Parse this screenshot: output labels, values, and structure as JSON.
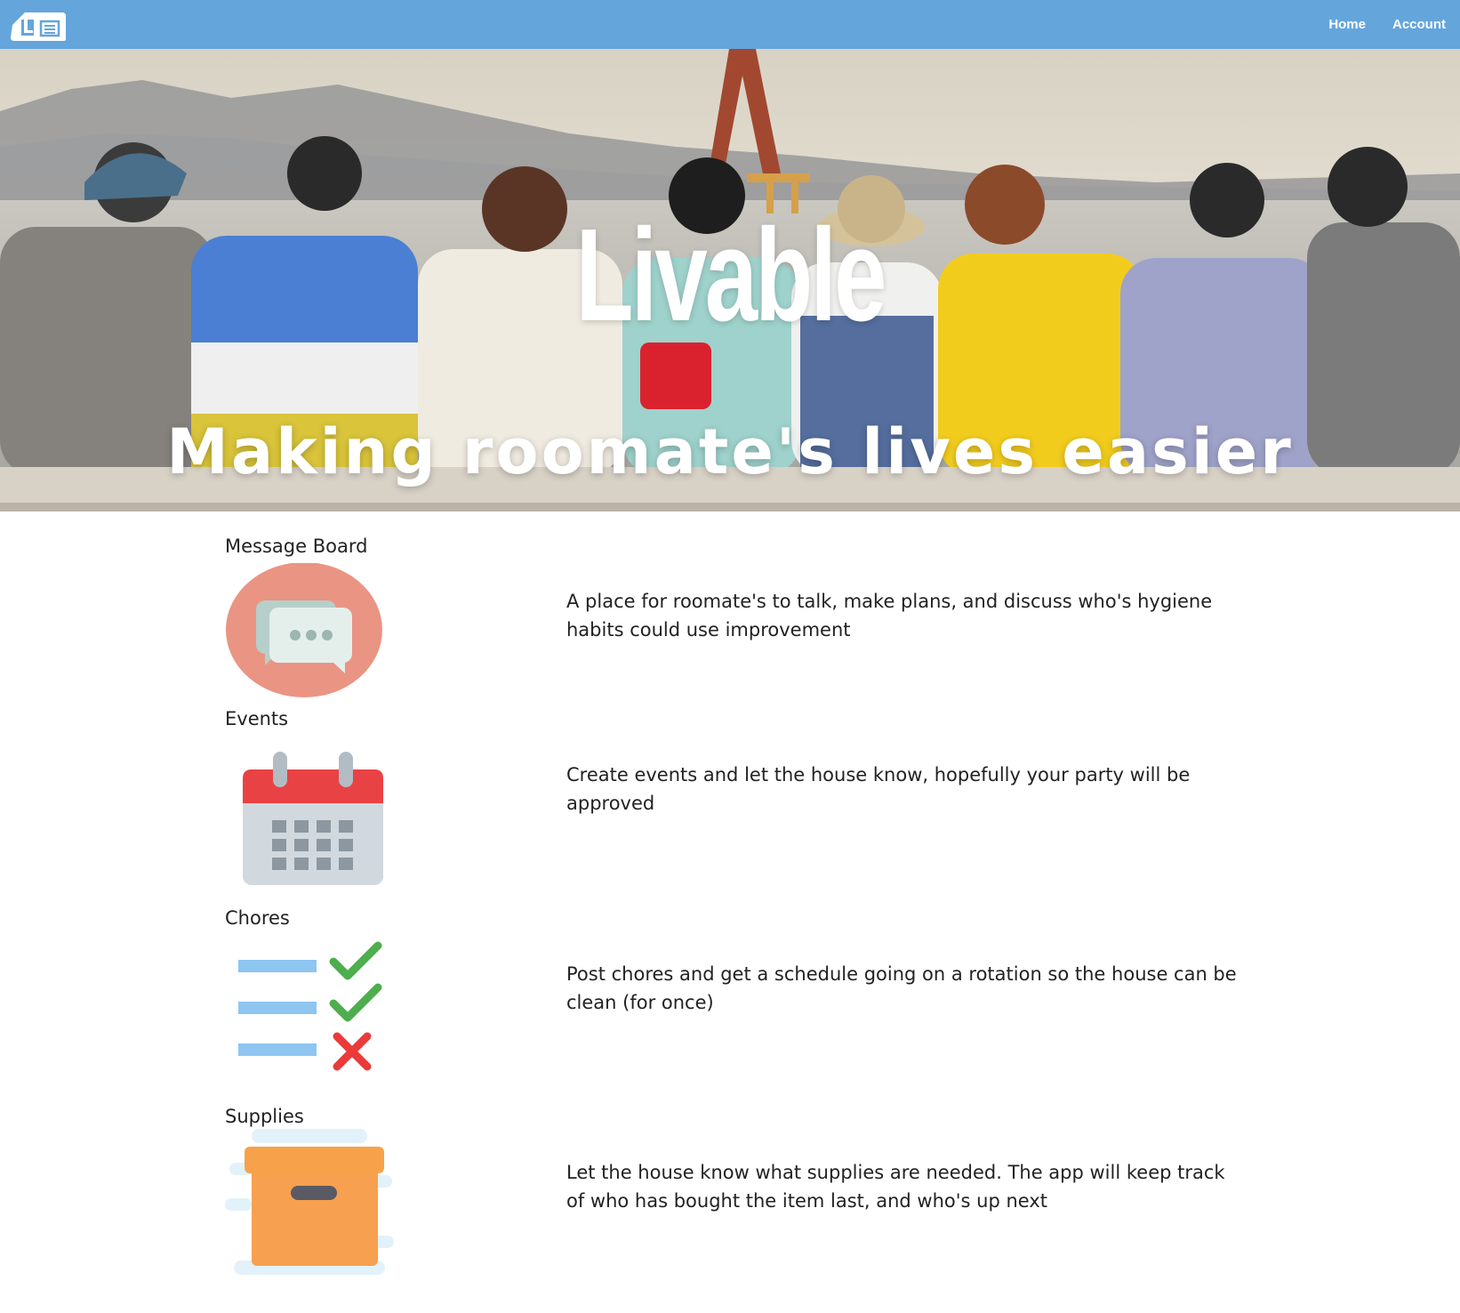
{
  "nav": {
    "logo_icon": "livable-house-logo",
    "home_label": "Home",
    "account_label": "Account"
  },
  "hero": {
    "title": "Livable",
    "subtitle": "Making roomate's lives easier",
    "image": "friends-sitting-by-the-sea-photo"
  },
  "features": [
    {
      "title": "Message Board",
      "icon": "chat-bubbles-icon",
      "description": "A place for roomate's to talk, make plans, and discuss who's hygiene habits could use improvement"
    },
    {
      "title": "Events",
      "icon": "calendar-icon",
      "description": "Create events and let the house know, hopefully your party will be approved"
    },
    {
      "title": "Chores",
      "icon": "checklist-icon",
      "description": "Post chores and get a schedule going on a rotation so the house can be clean (for once)"
    },
    {
      "title": "Supplies",
      "icon": "supply-box-icon",
      "description": "Let the house know what supplies are needed. The app will keep track of who has bought the item last, and who's up next"
    }
  ],
  "colors": {
    "navbar": "#64a5dc",
    "chat_circle": "#ea9483",
    "calendar_red": "#e94245",
    "check_green": "#4cae4c",
    "cross_red": "#ea3a3a",
    "box_orange": "#f7a24a"
  }
}
